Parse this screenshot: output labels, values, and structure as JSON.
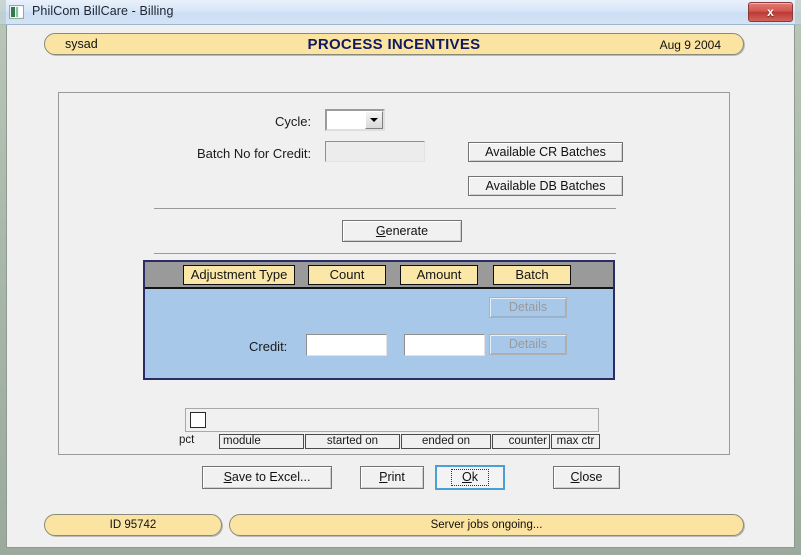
{
  "window": {
    "title": "PhilCom BillCare - Billing",
    "icon": "app-icon",
    "close_label": "x"
  },
  "header": {
    "user": "sysad",
    "title": "PROCESS INCENTIVES",
    "date": "Aug 9 2004"
  },
  "form": {
    "cycle_label": "Cycle:",
    "cycle_value": "",
    "batch_label": "Batch No for Credit:",
    "batch_value": "",
    "available_cr_label": "Available CR Batches",
    "available_db_label": "Available DB Batches",
    "generate_label": "Generate",
    "generate_accel": "G"
  },
  "grid": {
    "columns": [
      "Adjustment Type",
      "Count",
      "Amount",
      "Batch"
    ],
    "row_label": "Credit:",
    "row_value_1": "",
    "row_value_2": "",
    "details_label_1": "Details",
    "details_label_2": "Details"
  },
  "progress": {
    "percent_label": "pct",
    "module_label": "module",
    "started_label": "started on",
    "ended_label": "ended on",
    "counter_label": "counter",
    "maxctr_label": "max ctr"
  },
  "actions": {
    "save_accel": "S",
    "save_rest": "ave to Excel...",
    "print_accel": "P",
    "print_rest": "rint",
    "ok_accel": "O",
    "ok_rest": "k",
    "close_accel": "C",
    "close_rest": "lose"
  },
  "status": {
    "id": "ID 95742",
    "message": "Server jobs ongoing..."
  },
  "colors": {
    "pill": "#fbe3a1",
    "title_navy": "#111a5e",
    "grid_body": "#a8c8ea",
    "grid_border": "#2b2b66",
    "grid_header": "#9a9a9a"
  }
}
